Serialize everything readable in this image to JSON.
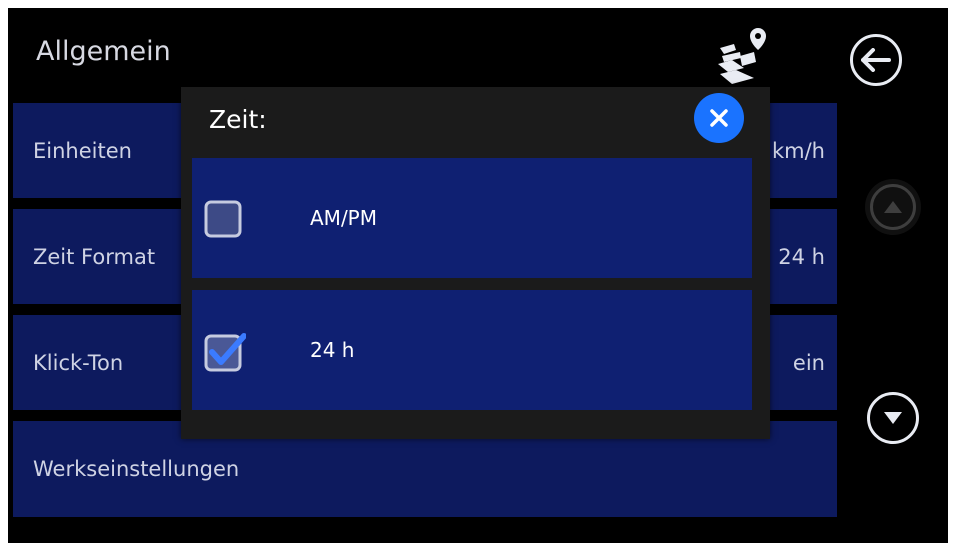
{
  "header": {
    "title": "Allgemein",
    "map_icon": "map-pin-icon",
    "back_icon": "back-arrow-icon"
  },
  "settings": {
    "rows": [
      {
        "label": "Einheiten",
        "value": "km/h"
      },
      {
        "label": "Zeit Format",
        "value": "24 h"
      },
      {
        "label": "Klick-Ton",
        "value": "ein"
      },
      {
        "label": "Werkseinstellungen",
        "value": ""
      }
    ]
  },
  "scroll": {
    "up_icon": "scroll-up-icon",
    "up_enabled": false,
    "down_icon": "scroll-down-icon"
  },
  "dialog": {
    "title": "Zeit:",
    "close_icon": "close-icon",
    "options": [
      {
        "label": "AM/PM",
        "checked": false
      },
      {
        "label": "24 h",
        "checked": true
      }
    ]
  },
  "colors": {
    "row_bg": "#0d1a5e",
    "option_bg": "#0f2072",
    "dialog_bg": "#1b1b1b",
    "accent": "#1a73ff"
  }
}
